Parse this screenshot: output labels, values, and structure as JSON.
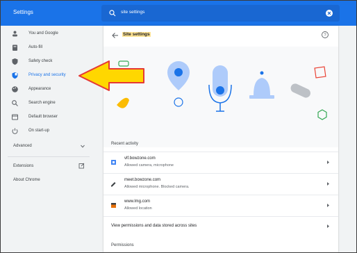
{
  "app": {
    "title": "Settings"
  },
  "search": {
    "value": "site settings"
  },
  "sidebar": {
    "items": [
      {
        "label": "You and Google",
        "icon": "person-icon"
      },
      {
        "label": "Auto-fill",
        "icon": "clipboard-icon"
      },
      {
        "label": "Safety check",
        "icon": "shield-icon"
      },
      {
        "label": "Privacy and security",
        "icon": "privacy-shield-icon",
        "active": true
      },
      {
        "label": "Appearance",
        "icon": "palette-icon"
      },
      {
        "label": "Search engine",
        "icon": "search-icon"
      },
      {
        "label": "Default browser",
        "icon": "browser-icon"
      },
      {
        "label": "On start-up",
        "icon": "power-icon"
      }
    ],
    "advanced_label": "Advanced",
    "extensions_label": "Extensions",
    "about_label": "About Chrome"
  },
  "main": {
    "title": "Site settings",
    "recent_heading": "Recent activity",
    "recent": [
      {
        "site": "vlf.bowzone.com",
        "details": "Allowed camera, microphone",
        "icon": "site-favicon-blue"
      },
      {
        "site": "meet.bowzone.com",
        "details": "Allowed microphone. Blocked camera.",
        "icon": "site-favicon-dark"
      },
      {
        "site": "www.lmg.com",
        "details": "Allowed location",
        "icon": "site-favicon-orange"
      }
    ],
    "view_all_label": "View permissions and data stored across sites",
    "permissions_heading": "Permissions"
  },
  "colors": {
    "accent": "#1a73e8",
    "highlight": "#fde293",
    "annotation_arrow": "#ffd700",
    "annotation_outline": "#e53935"
  }
}
